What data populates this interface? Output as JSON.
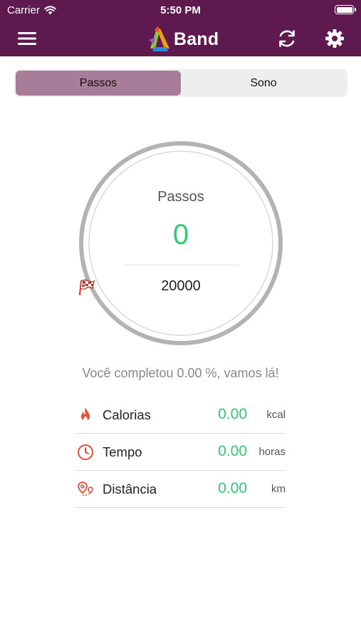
{
  "status_bar": {
    "carrier": "Carrier",
    "time": "5:50 PM",
    "wifi_icon": "wifi-icon",
    "battery_icon": "battery-icon"
  },
  "nav": {
    "brand": "Band",
    "menu_icon": "hamburger-menu-icon",
    "sync_icon": "sync-icon",
    "settings_icon": "gear-icon"
  },
  "tabs": [
    {
      "label": "Passos",
      "active": true
    },
    {
      "label": "Sono",
      "active": false
    }
  ],
  "steps": {
    "title": "Passos",
    "value": "0",
    "goal": "20000",
    "goal_icon": "checkered-flag-icon",
    "progress_fraction": 0.0
  },
  "progress_message": "Você completou 0.00 %, vamos lá!",
  "stats": [
    {
      "label": "Calorias",
      "value": "0.00",
      "unit": "kcal",
      "icon": "flame-icon"
    },
    {
      "label": "Tempo",
      "value": "0.00",
      "unit": "horas",
      "icon": "clock-icon"
    },
    {
      "label": "Distância",
      "value": "0.00",
      "unit": "km",
      "icon": "location-pin-icon"
    }
  ],
  "colors": {
    "primary": "#5e1a4e",
    "segment_active": "#a77d9a",
    "accent_green": "#2ecc71",
    "icon_red": "#e74c3c",
    "ring_gray": "#b3b3b3"
  }
}
